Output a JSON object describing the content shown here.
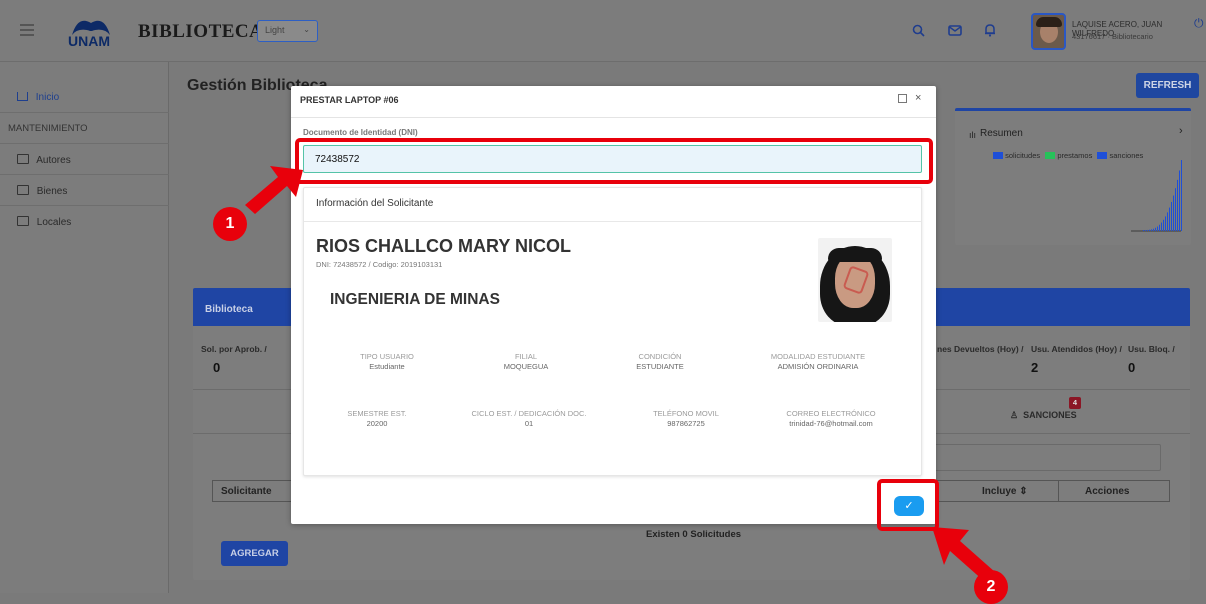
{
  "header": {
    "logo_text": "UNAM",
    "brand": "BIBLIOTECA",
    "theme_select": "Light",
    "user_name": "LAQUISE ACERO, JUAN WILFREDO",
    "user_role": "43176617 · Bibliotecario"
  },
  "sidebar": {
    "items": [
      {
        "label": "Inicio"
      },
      {
        "label": "MANTENIMIENTO"
      },
      {
        "label": "Autores"
      },
      {
        "label": "Bienes"
      },
      {
        "label": "Locales"
      }
    ]
  },
  "page": {
    "title": "Gestión Biblioteca",
    "refresh_label": "REFRESH"
  },
  "resumen": {
    "title": "Resumen",
    "legend": [
      "solicitudes",
      "prestamos",
      "sanciones"
    ],
    "colors": {
      "solicitudes": "#1e4fd8",
      "prestamos": "#27c25a",
      "sanciones": "#1e4fd8"
    }
  },
  "biblioteca": {
    "title": "Biblioteca",
    "stats": [
      {
        "label": "Sol. por Aprob. /",
        "value": "0"
      },
      {
        "label": "nes Devueltos (Hoy) /",
        "value": ""
      },
      {
        "label": "Usu. Atendidos (Hoy) /",
        "value": "2"
      },
      {
        "label": "Usu. Bloq. /",
        "value": "0"
      }
    ],
    "sanciones_tab": "SANCIONES",
    "sanciones_badge": "4",
    "columns": [
      "Solicitante",
      "Incluye ⇕",
      "Acciones"
    ],
    "empty_text": "Existen 0 Solicitudes",
    "add_label": "AGREGAR"
  },
  "modal": {
    "title": "PRESTAR LAPTOP #06",
    "dni_label": "Documento de Identidad (DNI)",
    "dni_value": "72438572",
    "info_title": "Información del Solicitante",
    "student_name": "RIOS CHALLCO MARY NICOL",
    "student_sub": "DNI: 72438572 / Codigo: 2019103131",
    "career": "INGENIERIA DE MINAS",
    "fields": [
      {
        "label": "TIPO USUARIO",
        "value": "Estudiante"
      },
      {
        "label": "FILIAL",
        "value": "MOQUEGUA"
      },
      {
        "label": "CONDICIÓN",
        "value": "ESTUDIANTE"
      },
      {
        "label": "MODALIDAD ESTUDIANTE",
        "value": "ADMISIÓN ORDINARIA"
      },
      {
        "label": "SEMESTRE EST.",
        "value": "20200"
      },
      {
        "label": "CICLO EST. / DEDICACIÓN DOC.",
        "value": "01"
      },
      {
        "label": "TELÉFONO MOVIL",
        "value": "987862725"
      },
      {
        "label": "CORREO ELECTRÓNICO",
        "value": "trinidad-76@hotmail.com"
      }
    ],
    "confirm_icon": "check-icon"
  },
  "annotations": {
    "step1": "1",
    "step2": "2",
    "highlight_color": "#e8000b"
  }
}
